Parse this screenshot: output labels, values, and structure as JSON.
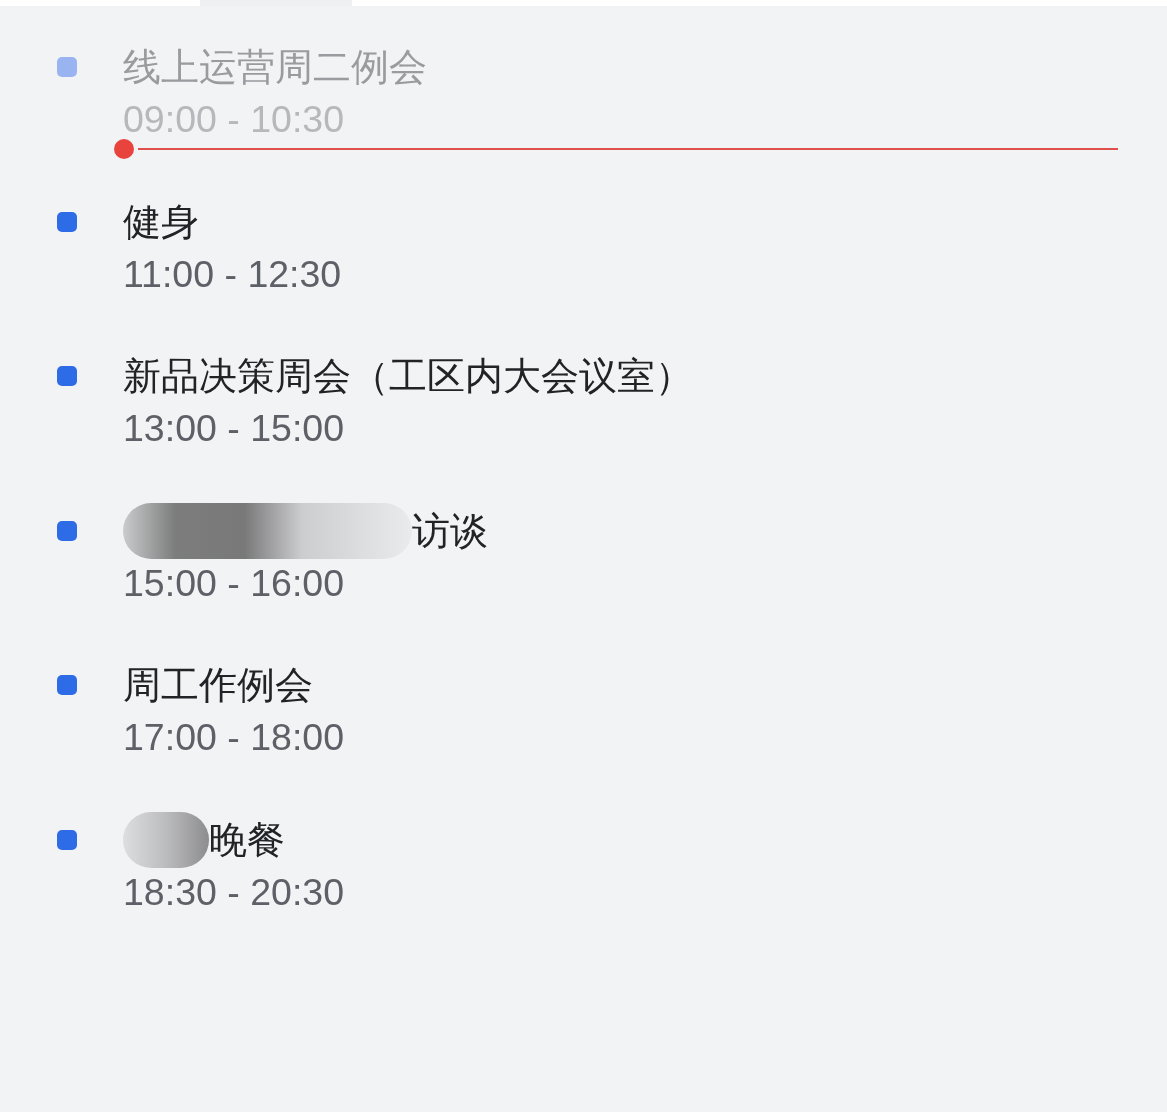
{
  "agenda": {
    "items": [
      {
        "kind": "event",
        "title": "线上运营周二例会",
        "time": "09:00 - 10:30",
        "past": true
      },
      {
        "kind": "now"
      },
      {
        "kind": "event",
        "title": "健身",
        "time": "11:00 - 12:30",
        "past": false
      },
      {
        "kind": "event",
        "title": "新品决策周会（工区内大会议室）",
        "time": "13:00 - 15:00",
        "past": false
      },
      {
        "kind": "event",
        "title": "访谈",
        "time": "15:00 - 16:00",
        "past": false,
        "redaction": {
          "kind": "wide"
        }
      },
      {
        "kind": "event",
        "title": "周工作例会",
        "time": "17:00 - 18:00",
        "past": false
      },
      {
        "kind": "event",
        "title": "晚餐",
        "time": "18:30 - 20:30",
        "past": false,
        "redaction": {
          "kind": "narrow"
        }
      }
    ]
  }
}
